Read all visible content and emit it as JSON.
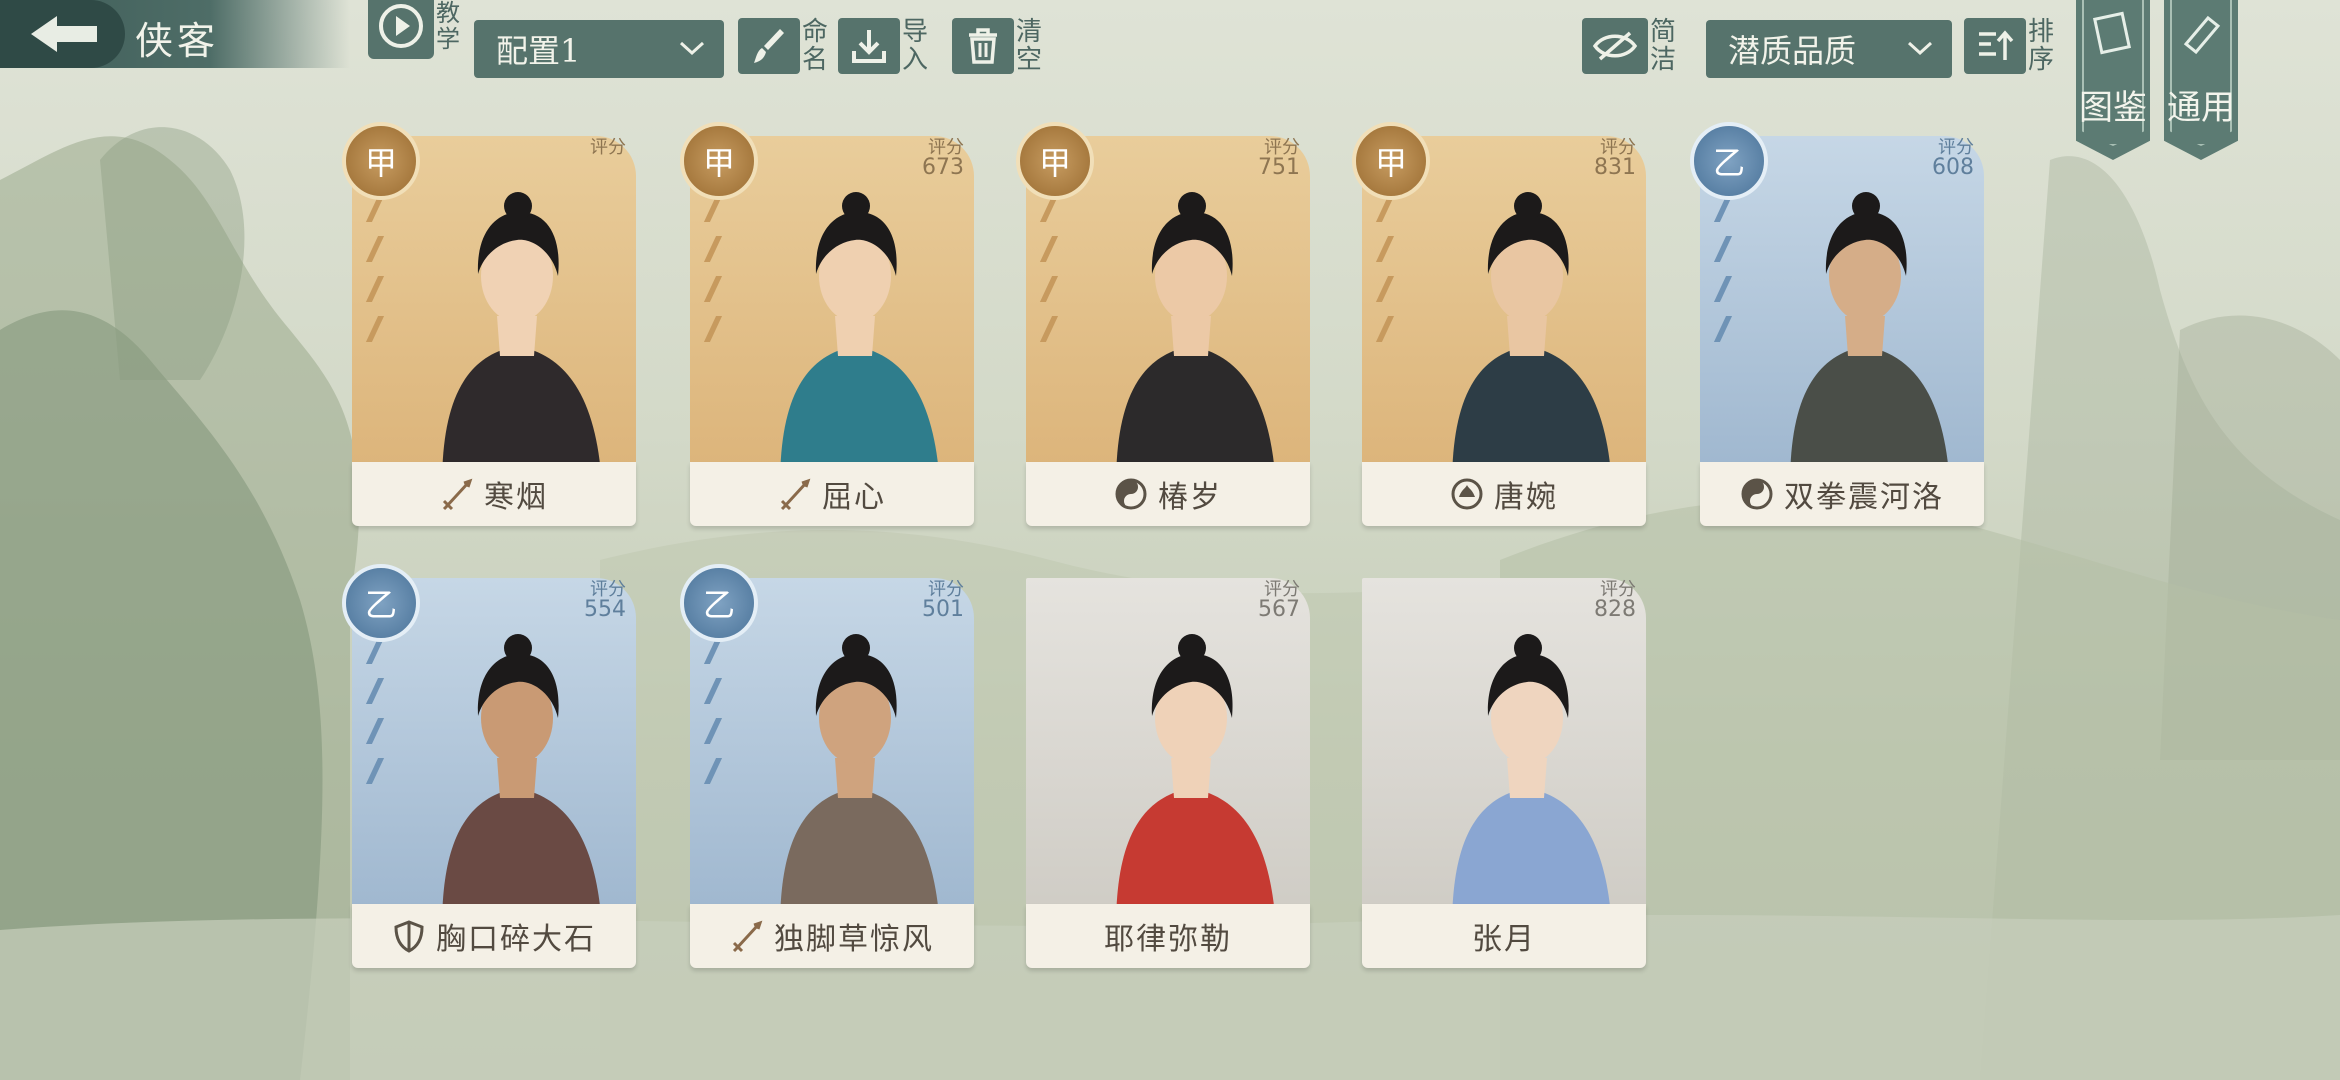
{
  "header": {
    "title": "侠客",
    "tutorial_label": "教学",
    "config_select": "配置1",
    "rename_label": "命名",
    "import_label": "导入",
    "clear_label": "清空",
    "concise_label": "简洁",
    "sort_select": "潜质品质",
    "sort_label": "排序",
    "codex_label": "图鉴",
    "general_label": "通用"
  },
  "score_label": "评分",
  "cards": [
    {
      "name": "寒烟",
      "grade": "甲",
      "score": "",
      "tier": "gold",
      "skill_icon": "sword-icon"
    },
    {
      "name": "屈心",
      "grade": "甲",
      "score": "673",
      "tier": "gold",
      "skill_icon": "sword-icon"
    },
    {
      "name": "椿岁",
      "grade": "甲",
      "score": "751",
      "tier": "gold",
      "skill_icon": "taiji-icon"
    },
    {
      "name": "唐婉",
      "grade": "甲",
      "score": "831",
      "tier": "gold",
      "skill_icon": "lotus-icon"
    },
    {
      "name": "双拳震河洛",
      "grade": "乙",
      "score": "608",
      "tier": "blue",
      "skill_icon": "taiji-icon"
    },
    {
      "name": "胸口碎大石",
      "grade": "乙",
      "score": "554",
      "tier": "blue",
      "skill_icon": "shield-icon"
    },
    {
      "name": "独脚草惊风",
      "grade": "乙",
      "score": "501",
      "tier": "blue",
      "skill_icon": "sword-icon"
    },
    {
      "name": "耶律弥勒",
      "grade": "",
      "score": "567",
      "tier": "gray",
      "skill_icon": ""
    },
    {
      "name": "张月",
      "grade": "",
      "score": "828",
      "tier": "gray",
      "skill_icon": ""
    }
  ],
  "colors": {
    "teal": "#56736c",
    "gold": "#dcb47a",
    "blue": "#9fb7cf",
    "gray": "#cfccc5"
  }
}
